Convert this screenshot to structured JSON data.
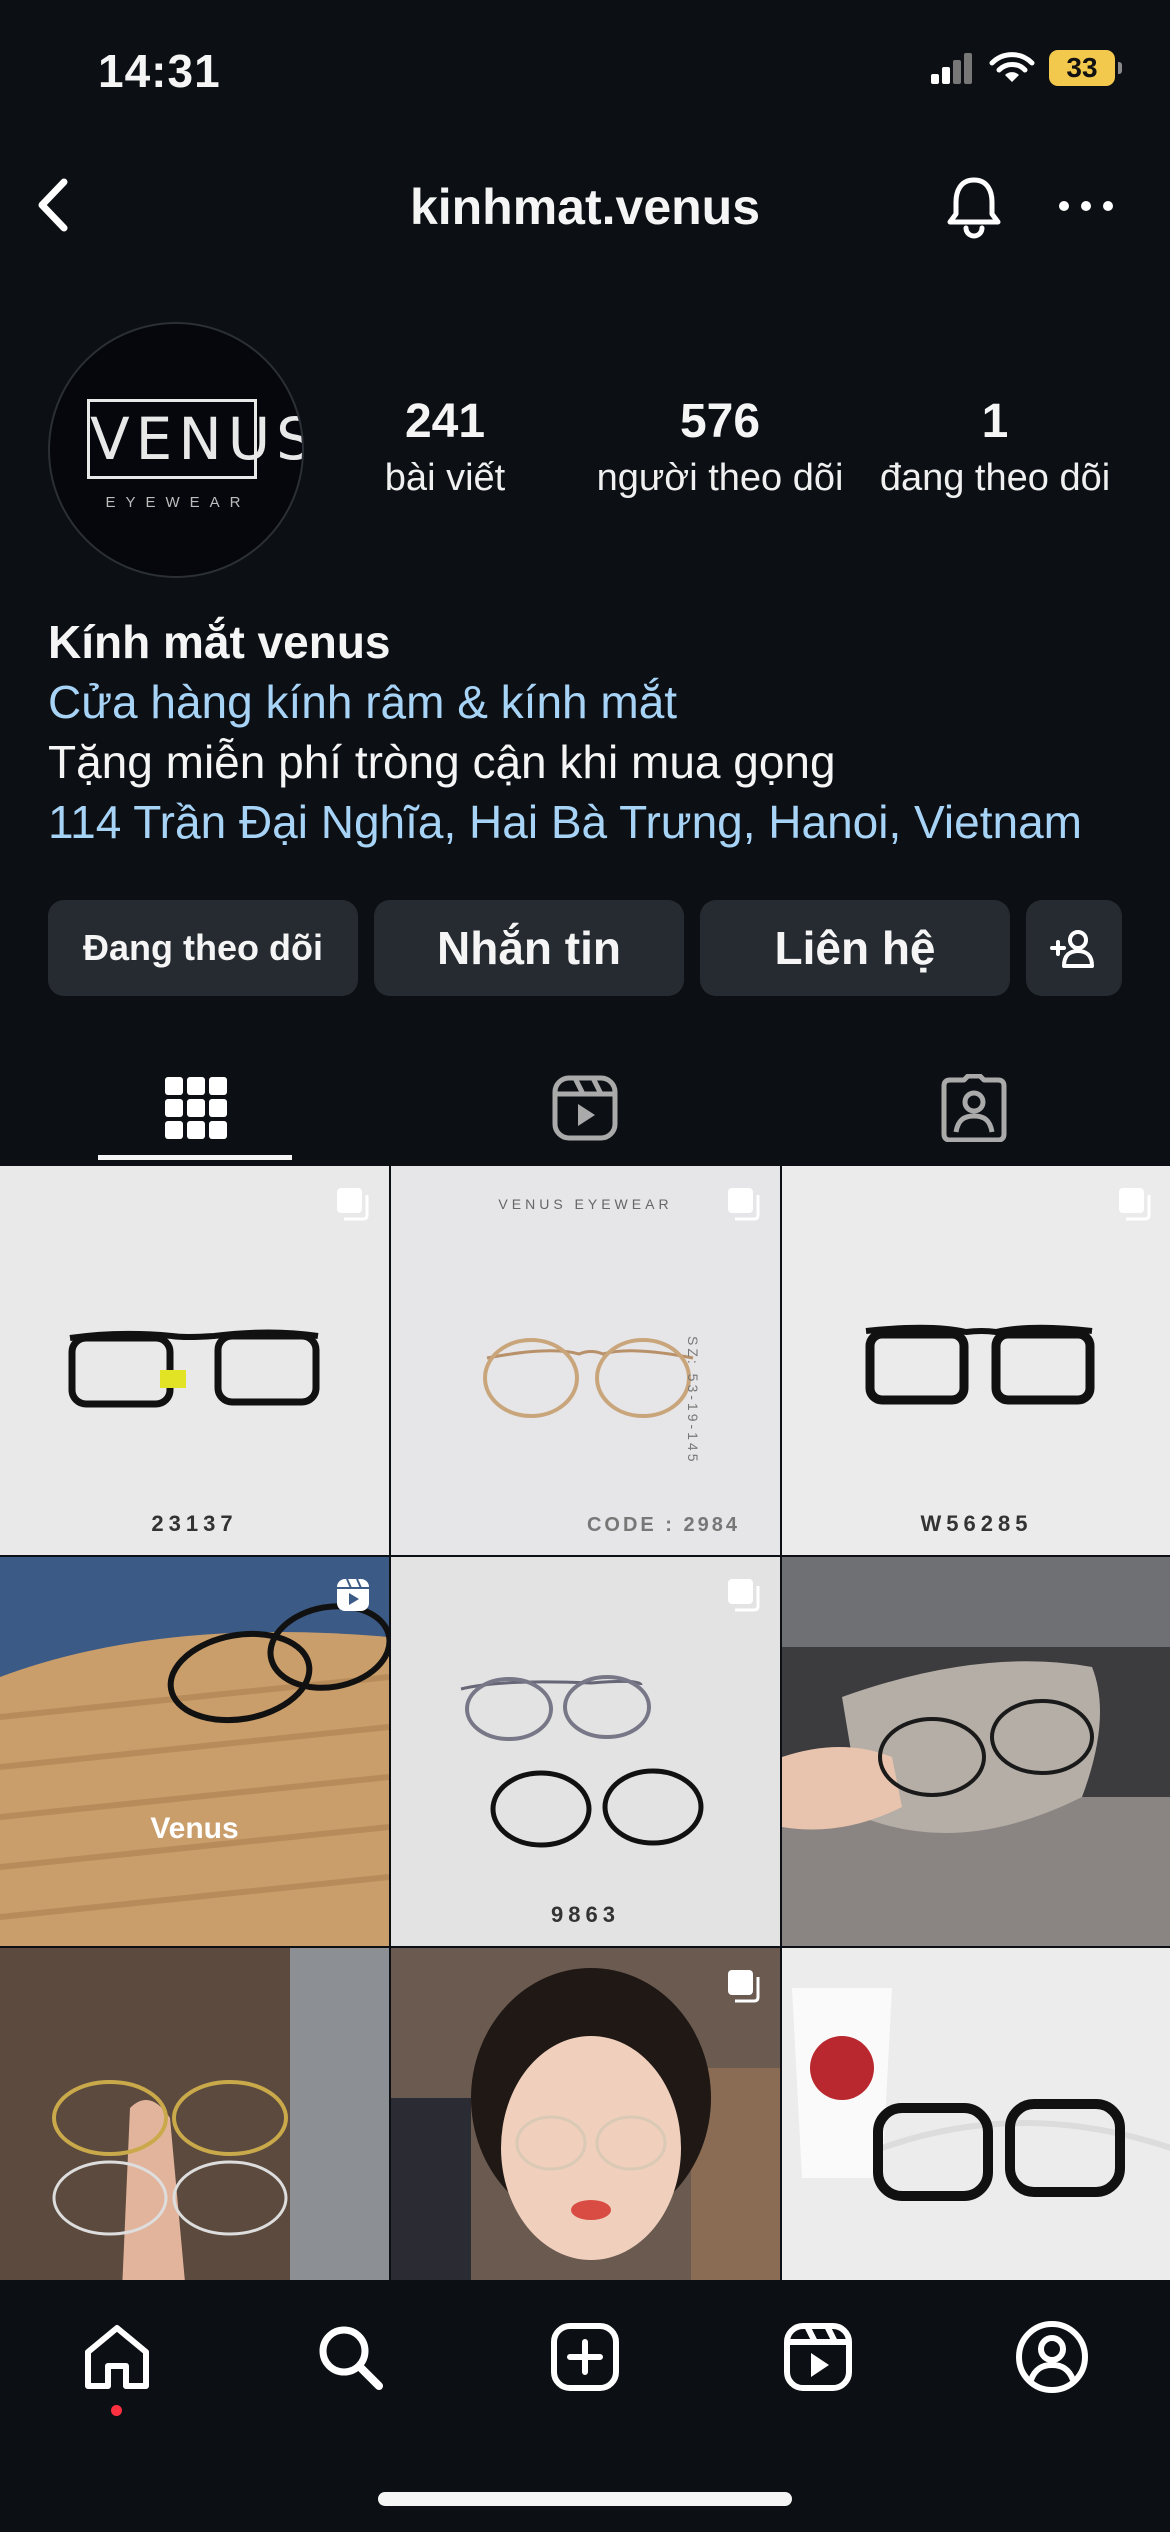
{
  "status_bar": {
    "time": "14:31",
    "battery": "33"
  },
  "nav": {
    "username": "kinhmat.venus"
  },
  "profile": {
    "avatar_logo": "VENUS",
    "avatar_sub": "EYEWEAR",
    "stats": [
      {
        "value": "241",
        "label": "bài viết"
      },
      {
        "value": "576",
        "label": "người theo dõi"
      },
      {
        "value": "1",
        "label": "đang theo dõi"
      }
    ],
    "name": "Kính mắt venus",
    "category": "Cửa hàng kính râm & kính mắt",
    "bio": "Tặng miễn phí tròng cận khi mua gọng",
    "address": "114 Trần Đại Nghĩa, Hai Bà Trưng, Hanoi, Vietnam"
  },
  "actions": {
    "following": "Đang theo dõi",
    "message": "Nhắn tin",
    "contact": "Liên hệ"
  },
  "tabs": [
    "posts-grid",
    "reels",
    "tagged"
  ],
  "posts": [
    {
      "caption": "23137",
      "type": "carousel"
    },
    {
      "caption": "CODE : 2984",
      "header": "VENUS EYEWEAR",
      "side": "SZ: 53-19-145",
      "type": "carousel"
    },
    {
      "caption": "W56285",
      "type": "carousel"
    },
    {
      "watermark": "Venus",
      "type": "reel"
    },
    {
      "caption": "9863",
      "type": "carousel"
    },
    {
      "type": "photo"
    },
    {
      "type": "photo"
    },
    {
      "type": "carousel"
    },
    {
      "type": "photo"
    }
  ],
  "bottom_nav": [
    "home-icon",
    "search-icon",
    "create-icon",
    "reels-icon",
    "profile-icon"
  ],
  "colors": {
    "background": "#0c1014",
    "button": "#262b31",
    "link": "#a7d3f7",
    "battery": "#f2c94c",
    "notification_dot": "#ff3040"
  }
}
